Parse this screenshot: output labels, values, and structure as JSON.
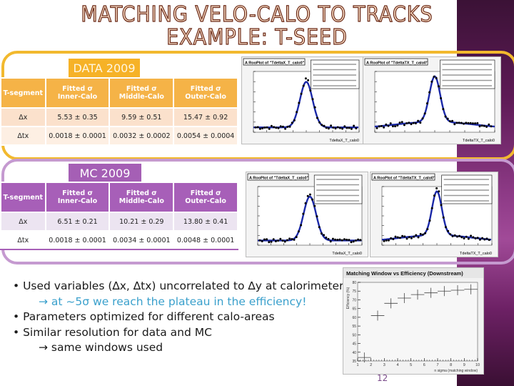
{
  "slide": {
    "title_line1": "MATCHING VELO-CALO TO TRACKS",
    "title_line2": "EXAMPLE: T-SEED",
    "page_number": "12"
  },
  "data_panel": {
    "tag": "DATA 2009",
    "headers": [
      "T-segment",
      "Fitted σ Inner-Calo",
      "Fitted σ Middle-Calo",
      "Fitted σ Outer-Calo"
    ],
    "header_lines": [
      [
        "T-segment",
        ""
      ],
      [
        "Fitted σ",
        "Inner-Calo"
      ],
      [
        "Fitted σ",
        "Middle-Calo"
      ],
      [
        "Fitted σ",
        "Outer-Calo"
      ]
    ],
    "rows": [
      [
        "Δx",
        "5.53 ± 0.35",
        "9.59 ± 0.51",
        "15.47 ± 0.92"
      ],
      [
        "Δtx",
        "0.0018 ± 0.0001",
        "0.0032 ± 0.0002",
        "0.0054 ± 0.0004"
      ]
    ],
    "plots": [
      {
        "title": "A RooPlot of \"TdeltaX_T_calo0\"",
        "xlabel": "TdeltaX_T_calo0"
      },
      {
        "title": "A RooPlot of \"TdeltaTX_T_calo0\"",
        "xlabel": "TdeltaTX_T_calo0"
      }
    ]
  },
  "mc_panel": {
    "tag": "MC 2009",
    "header_lines": [
      [
        "T-segment",
        ""
      ],
      [
        "Fitted σ",
        "Inner-Calo"
      ],
      [
        "Fitted σ",
        "Middle-Calo"
      ],
      [
        "Fitted σ",
        "Outer-Calo"
      ]
    ],
    "rows": [
      [
        "Δx",
        "6.51 ± 0.21",
        "10.21 ± 0.29",
        "13.80 ± 0.41"
      ],
      [
        "Δtx",
        "0.0018 ± 0.0001",
        "0.0034 ± 0.0001",
        "0.0048 ± 0.0001"
      ]
    ],
    "plots": [
      {
        "title": "A RooPlot of \"TdeltaX_T_calo0\"",
        "xlabel": "TdeltaX_T_calo0"
      },
      {
        "title": "A RooPlot of \"TdeltaTX_T_calo0\"",
        "xlabel": "TdeltaTX_T_calo0"
      }
    ]
  },
  "bullets": [
    {
      "text": "• Used variables (∆x, ∆tx) uncorrelated to ∆y at calorimeter",
      "indent": false,
      "highlight": false
    },
    {
      "text": "→ at ~5σ we reach the plateau in the efficiency!",
      "indent": true,
      "highlight": true
    },
    {
      "text": "• Parameters optimized for different calo-areas",
      "indent": false,
      "highlight": false
    },
    {
      "text": "• Similar resolution for data and MC",
      "indent": false,
      "highlight": false
    },
    {
      "text": "→ same windows used",
      "indent": true,
      "highlight": false
    }
  ],
  "colors": {
    "data_accent": "#f2b92e",
    "mc_accent": "#a75fb8",
    "highlight": "#3aa0cc"
  },
  "chart_data": {
    "type": "scatter",
    "title": "Matching Window vs Efficiency (Downstream)",
    "xlabel": "n sigma (matching window)",
    "ylabel": "Efficiency (%)",
    "x": [
      1.5,
      2.5,
      3.5,
      4.5,
      5.5,
      6.5,
      7.5,
      8.5,
      9.5
    ],
    "values": [
      37,
      61,
      68,
      71,
      73,
      74,
      75,
      75.5,
      76
    ],
    "xlim": [
      1,
      10
    ],
    "ylim": [
      35,
      80
    ],
    "xticks": [
      "1",
      "2",
      "3",
      "4",
      "5",
      "6",
      "7",
      "8",
      "9",
      "10"
    ],
    "yticks": [
      "35",
      "40",
      "45",
      "50",
      "55",
      "60",
      "65",
      "70",
      "75",
      "80"
    ],
    "grid": false,
    "legend": "none"
  }
}
